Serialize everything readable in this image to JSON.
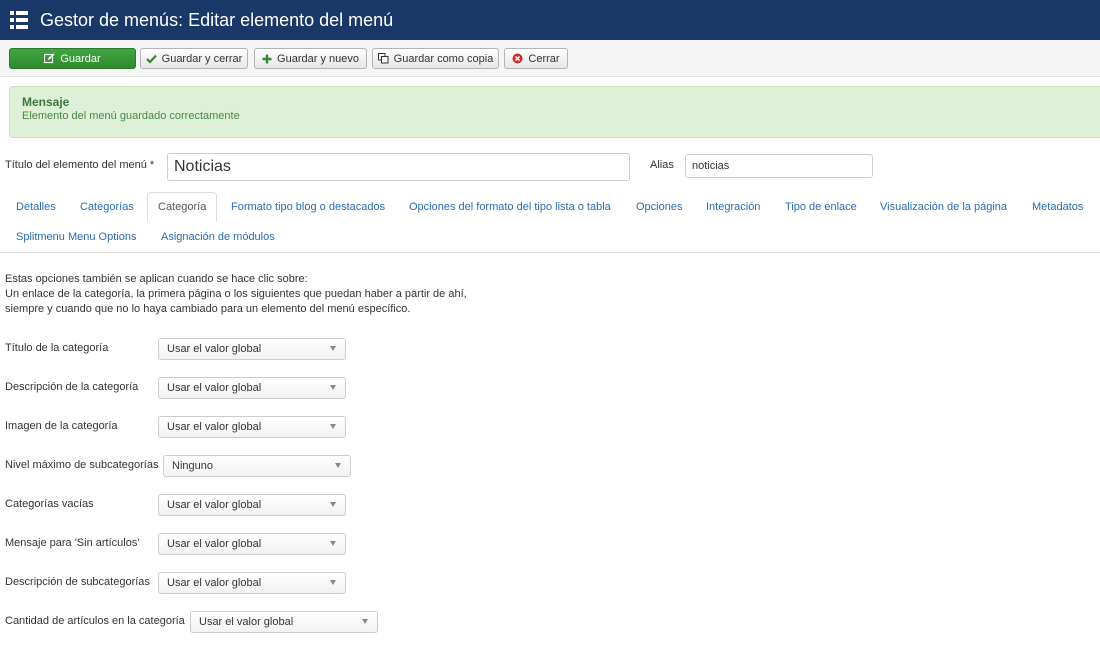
{
  "header": {
    "title": "Gestor de menús: Editar elemento del menú",
    "icon": "list-icon"
  },
  "toolbar": {
    "save": "Guardar",
    "save_close": "Guardar y cerrar",
    "save_new": "Guardar y nuevo",
    "save_copy": "Guardar como copia",
    "close": "Cerrar",
    "save_color": "#2f8a2f"
  },
  "alert": {
    "heading": "Mensaje",
    "message": "Elemento del menú guardado correctamente"
  },
  "form": {
    "title_label": "Título del elemento del menú *",
    "title_value": "Noticias",
    "alias_label": "Alias",
    "alias_value": "noticias"
  },
  "tabs": [
    "Detalles",
    "Categorías",
    "Categoría",
    "Formato tipo blog o destacados",
    "Opciones del formato del tipo lista o tabla",
    "Opciones",
    "Integración",
    "Tipo de enlace",
    "Visualización de la página",
    "Metadatos",
    "Splitmenu Menu Options",
    "Asignación de módulos"
  ],
  "active_tab": "Categoría",
  "intro": [
    "Estas opciones también se aplican cuando se hace clic sobre:",
    "Un enlace de la categoría, la primera página o los siguientes que puedan haber a partir de ahí,",
    "siempre y cuando que no lo haya cambiado para un elemento del menú específico."
  ],
  "fields": [
    {
      "label": "Título de la categoría",
      "value": "Usar el valor global"
    },
    {
      "label": "Descripción de la categoría",
      "value": "Usar el valor global"
    },
    {
      "label": "Imagen de la categoría",
      "value": "Usar el valor global"
    },
    {
      "label": "Nivel máximo de subcategorías",
      "value": "Ninguno"
    },
    {
      "label": "Categorías vacías",
      "value": "Usar el valor global"
    },
    {
      "label": "Mensaje para 'Sin artículos'",
      "value": "Usar el valor global"
    },
    {
      "label": "Descripción de subcategorías",
      "value": "Usar el valor global"
    },
    {
      "label": "Cantidad de artículos en la categoría",
      "value": "Usar el valor global"
    }
  ]
}
